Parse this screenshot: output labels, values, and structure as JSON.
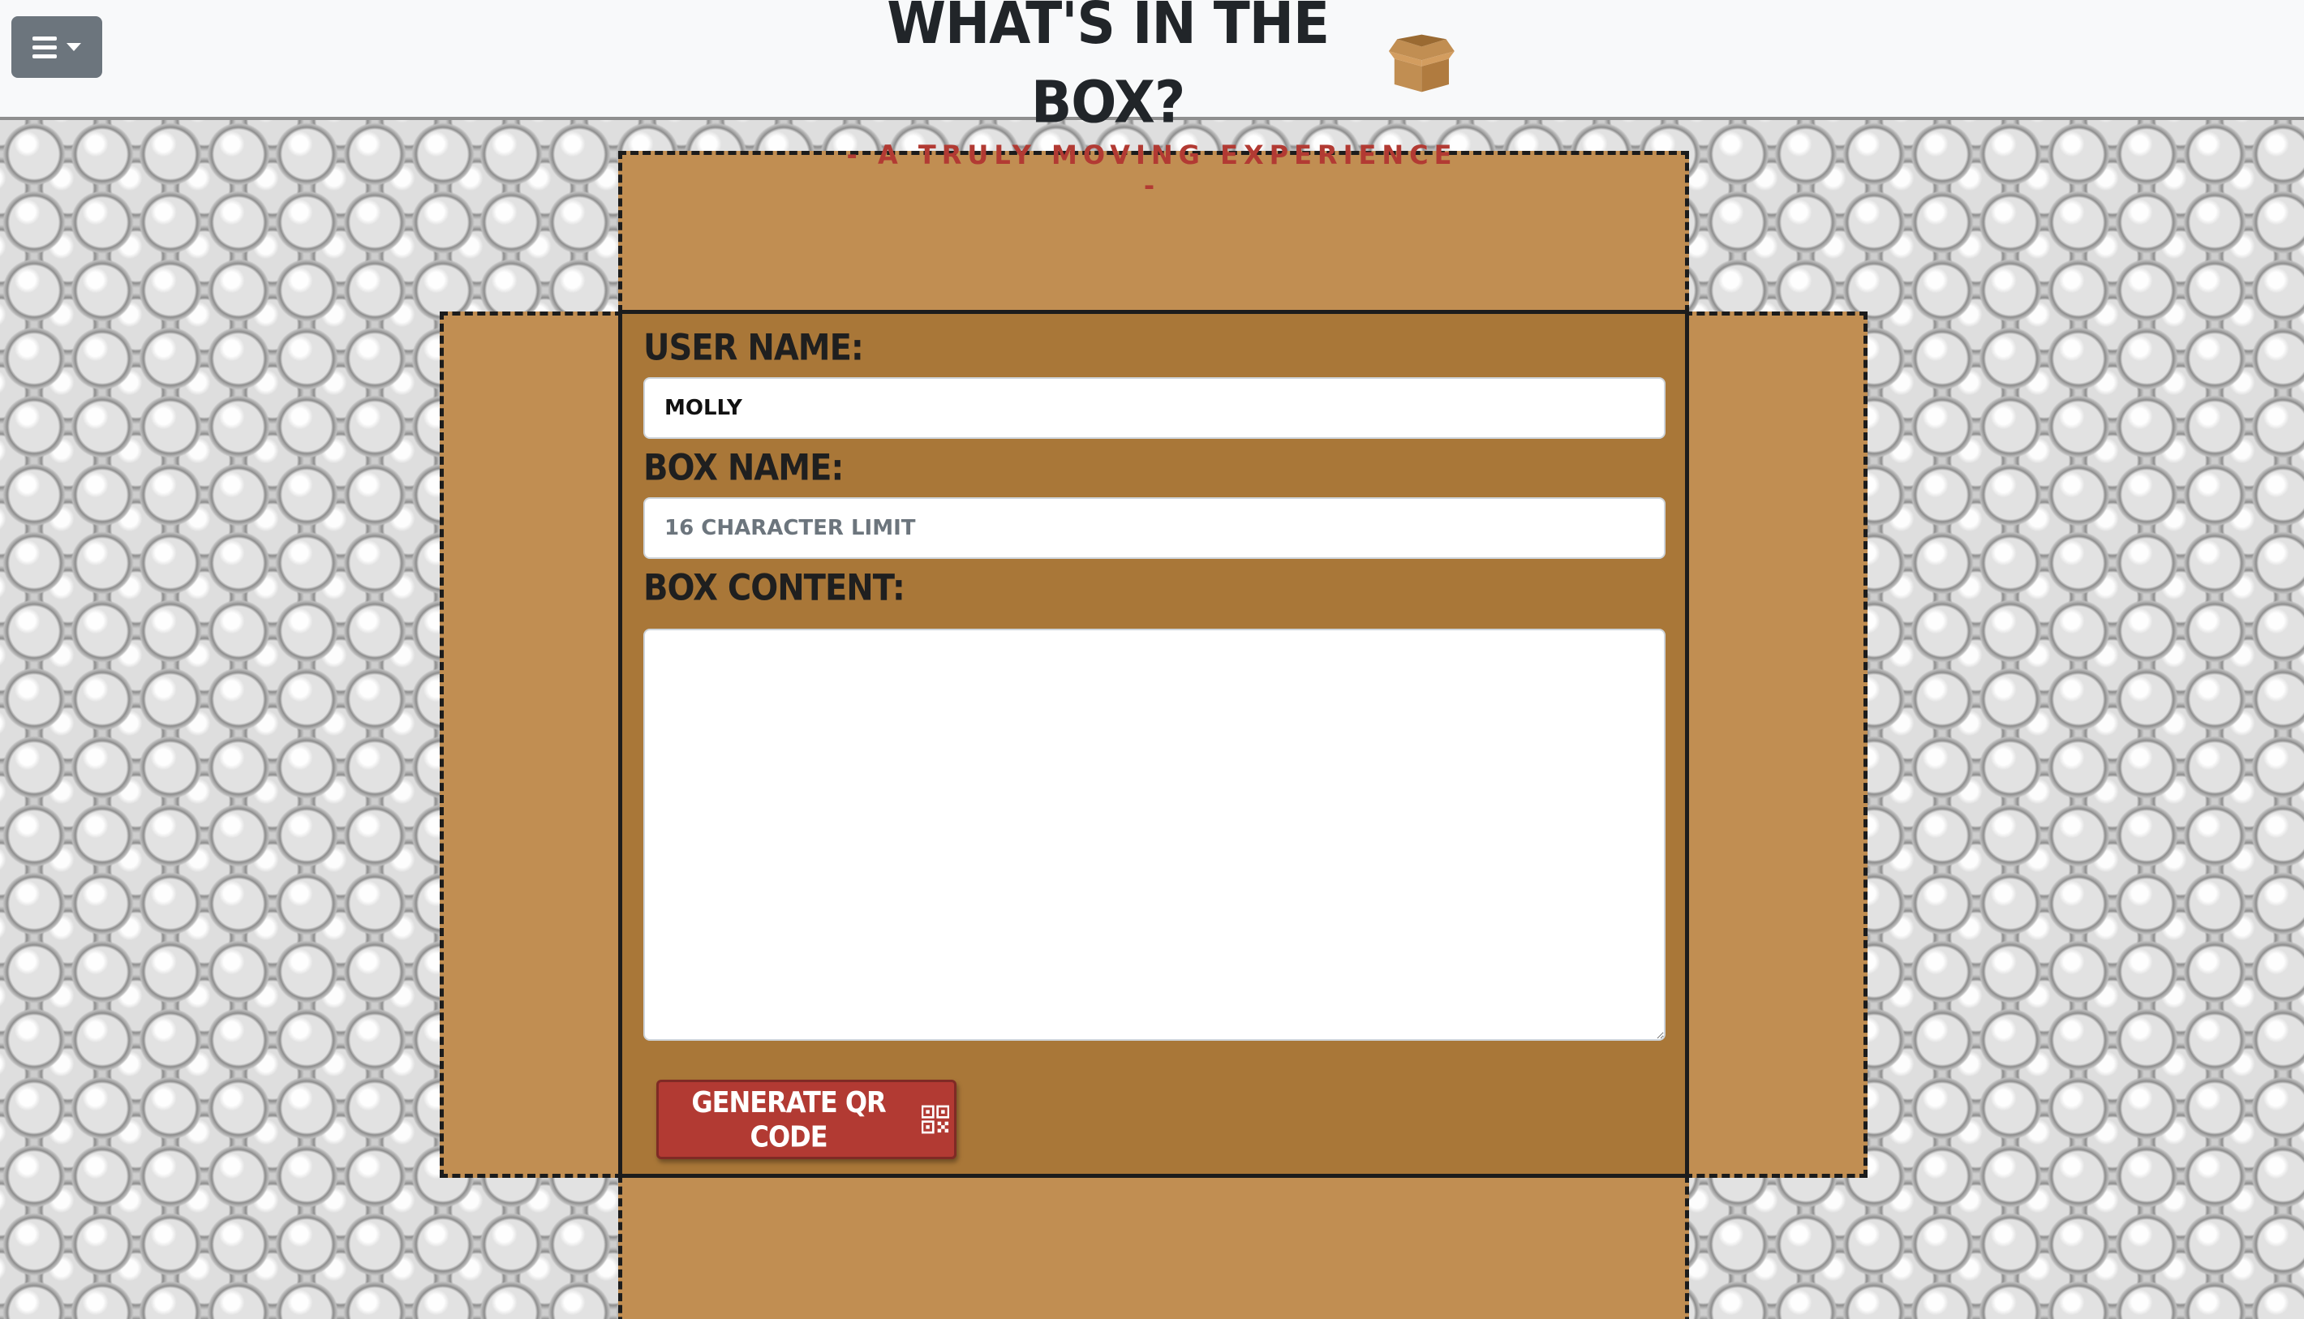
{
  "header": {
    "menu_icon": "hamburger-icon",
    "dropdown_icon": "caret-down-icon",
    "title": "WHAT'S IN THE BOX?",
    "logo_icon": "open-box-icon",
    "subtitle": "- A TRULY MOVING EXPERIENCE -"
  },
  "form": {
    "user_name_label": "USER NAME:",
    "user_name_value": "MOLLY",
    "box_name_label": "BOX NAME:",
    "box_name_placeholder": "16 CHARACTER LIMIT",
    "box_content_label": "BOX CONTENT:",
    "box_content_value": "",
    "submit_label": "GENERATE QR CODE",
    "submit_icon": "qr-code-icon"
  },
  "colors": {
    "box_inner": "#a97738",
    "box_flap": "#c18e52",
    "accent_red": "#b23a33",
    "header_bg": "#f8f9fa",
    "menu_button": "#6c757d"
  }
}
